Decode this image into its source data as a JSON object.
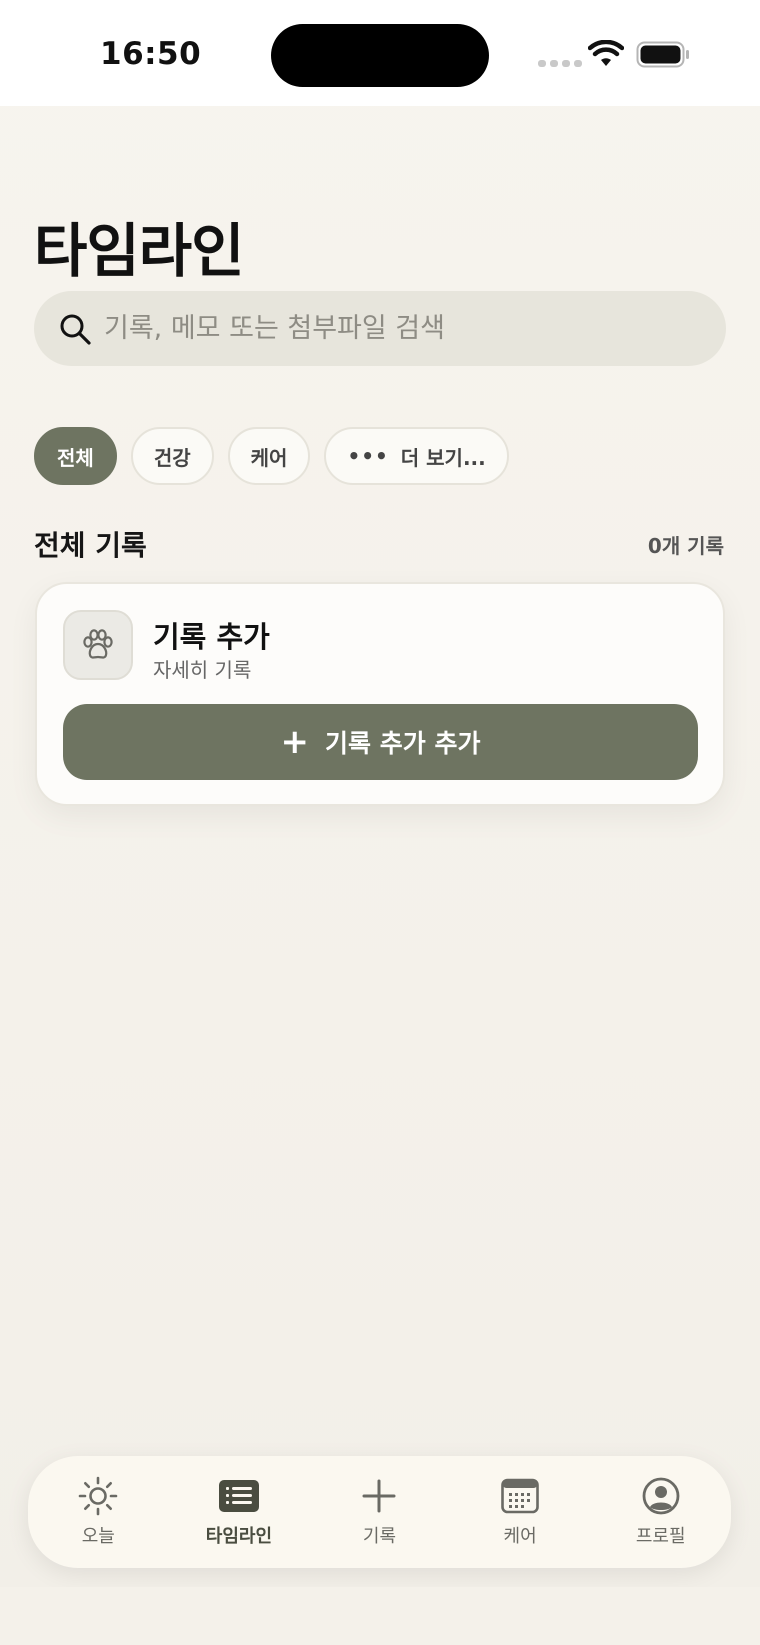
{
  "status_bar": {
    "time": "16:50"
  },
  "header": {
    "title": "타임라인"
  },
  "search": {
    "placeholder": "기록, 메모 또는 첨부파일 검색"
  },
  "filters": {
    "chips": [
      {
        "label": "전체",
        "active": true
      },
      {
        "label": "건강",
        "active": false
      },
      {
        "label": "케어",
        "active": false
      }
    ],
    "more_label": "더 보기..."
  },
  "section": {
    "title": "전체 기록",
    "count": "0개 기록"
  },
  "card": {
    "title": "기록 추가",
    "subtitle": "자세히 기록",
    "button_label": "기록 추가 추가",
    "icon": "paw-icon"
  },
  "tab_bar": {
    "tabs": [
      {
        "label": "오늘",
        "icon": "sun-icon"
      },
      {
        "label": "타임라인",
        "icon": "list-icon",
        "active": true
      },
      {
        "label": "기록",
        "icon": "plus-icon"
      },
      {
        "label": "케어",
        "icon": "calendar-icon"
      },
      {
        "label": "프로필",
        "icon": "profile-icon"
      }
    ]
  },
  "colors": {
    "accent": "#6e7461",
    "background": "#f6f3ec",
    "card": "#fdfcfa"
  }
}
